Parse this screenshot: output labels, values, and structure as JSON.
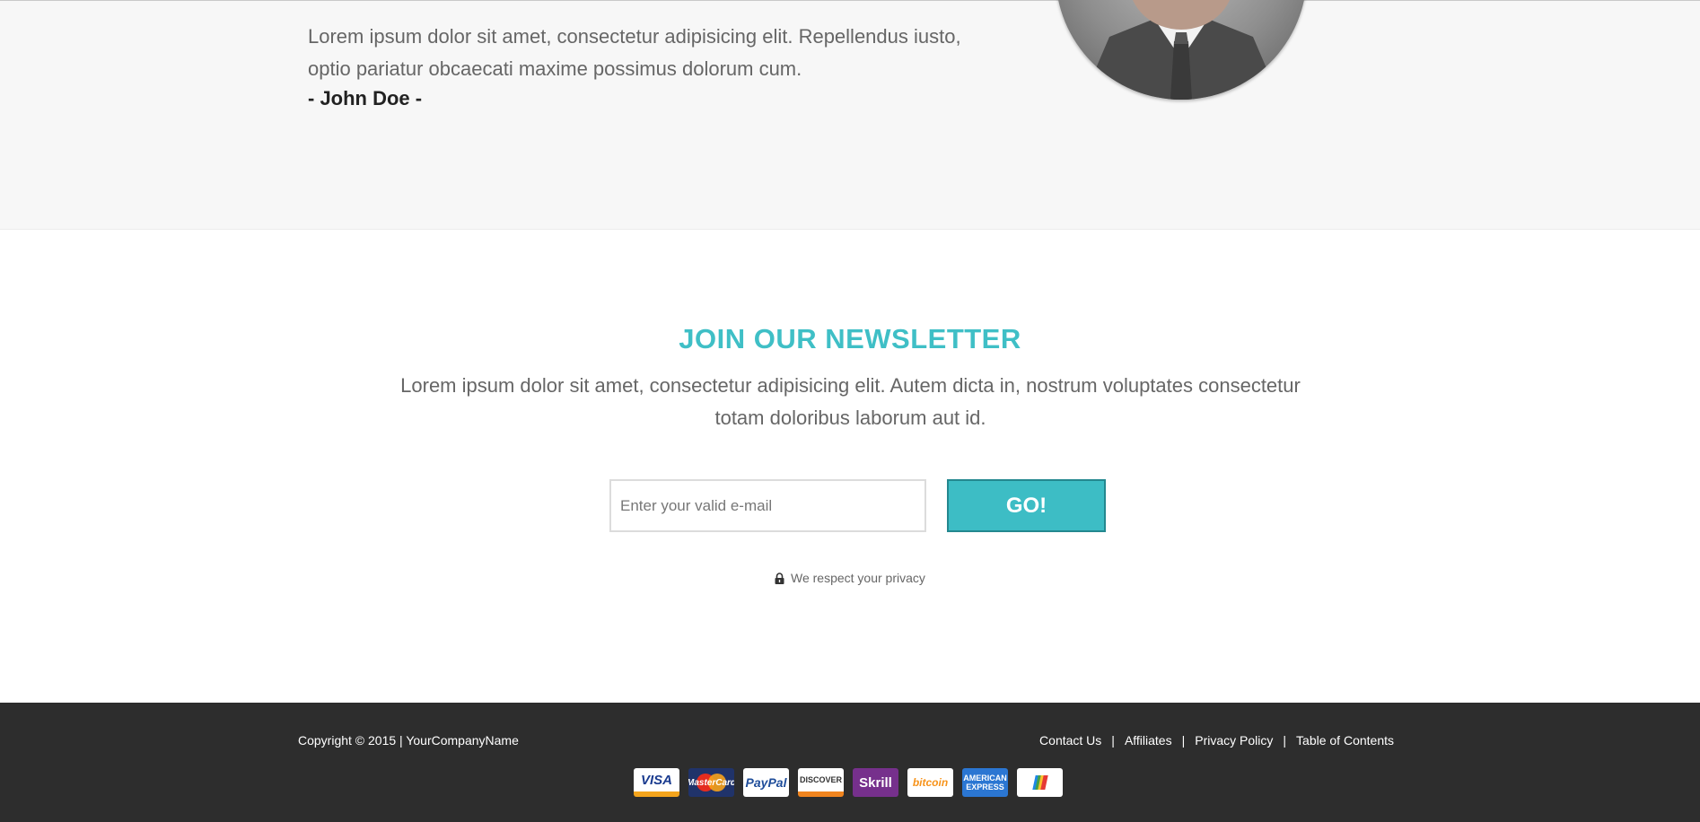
{
  "testimonial": {
    "quote": "Lorem ipsum dolor sit amet, consectetur adipisicing elit. Repellendus iusto, optio pariatur obcaecati maxime possimus dolorum cum.",
    "author": "- John Doe -"
  },
  "newsletter": {
    "title": "JOIN OUR NEWSLETTER",
    "description": "Lorem ipsum dolor sit amet, consectetur adipisicing elit. Autem dicta in, nostrum voluptates consectetur totam doloribus laborum aut id.",
    "email_placeholder": "Enter your valid e-mail",
    "submit_label": "GO!",
    "privacy_text": "We respect your privacy"
  },
  "footer": {
    "copyright": "Copyright © 2015 | YourCompanyName",
    "links": [
      "Contact Us",
      "Affiliates",
      "Privacy Policy",
      "Table of Contents"
    ],
    "payment_methods": [
      "VISA",
      "MasterCard",
      "PayPal",
      "DISCOVER",
      "Skrill",
      "bitcoin",
      "AMERICAN EXPRESS",
      "Google Wallet"
    ]
  },
  "colors": {
    "accent": "#3dbdc5",
    "footer_bg": "#2d2d2d",
    "testimonial_bg": "#f7f7f7"
  }
}
